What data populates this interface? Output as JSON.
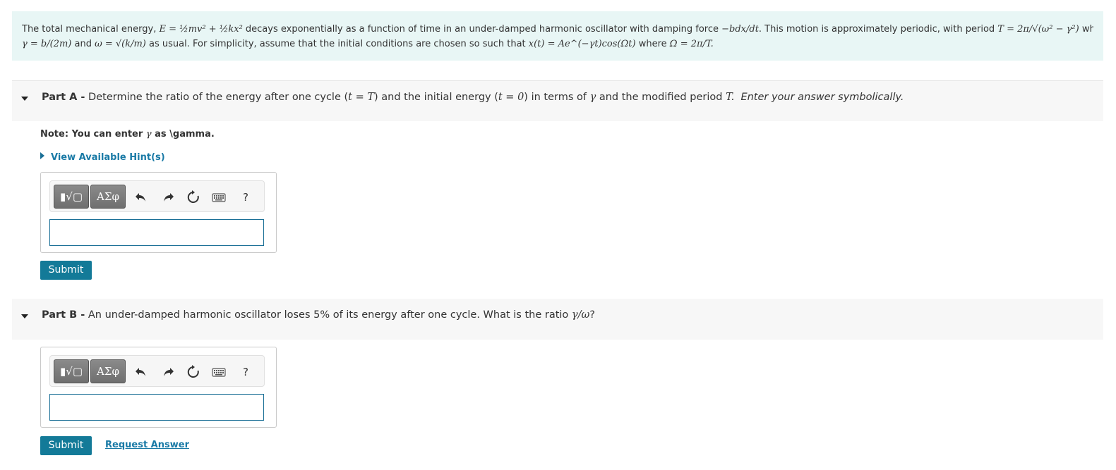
{
  "intro": {
    "line1_prefix": "The total mechanical energy, ",
    "line1_eq_energy": "E = ½mv² + ½kx²",
    "line1_mid": " decays exponentially as a function of time in an under-damped harmonic oscillator with damping force ",
    "line1_eq_force": "−bdx/dt",
    "line1_mid2": ". This motion is approximately periodic, with period ",
    "line1_eq_period": "T = 2π/√(ω² − γ²)",
    "line1_suffix": " where",
    "line2_eq_gamma": "γ = b/(2m)",
    "line2_and": " and ",
    "line2_eq_omega": "ω = √(k/m)",
    "line2_mid": " as usual. For simplicity, assume that the initial conditions are chosen so such that ",
    "line2_eq_x": "x(t) = Ae^(−γt)cos(Ωt)",
    "line2_where": " where ",
    "line2_eq_Omega": "Ω = 2π/T."
  },
  "part_a": {
    "name": "Part A -",
    "text1": " Determine the ratio of the energy after one cycle (",
    "eq1": "t = T",
    "text2": ") and the initial energy (",
    "eq2": "t = 0",
    "text3": ") in terms of ",
    "eq3": "γ",
    "text4": " and the modified period ",
    "eq4": "T.",
    "instruction": "Enter your answer symbolically.",
    "note_prefix": "Note: You can enter ",
    "note_symbol": "γ",
    "note_suffix": " as \\gamma.",
    "hint_label": "View Available Hint(s)",
    "submit_label": "Submit"
  },
  "part_b": {
    "name": "Part B -",
    "text": " An under-damped harmonic oscillator loses 5% of its energy after one cycle. What is the ratio ",
    "eq": "γ/ω",
    "text_end": "?",
    "submit_label": "Submit",
    "request_label": "Request Answer"
  },
  "toolbar": {
    "templates_label": "▮√▢",
    "symbols_label": "ΑΣφ",
    "help_label": "?"
  },
  "icons": [
    "templates-icon",
    "symbols-icon",
    "undo-icon",
    "redo-icon",
    "reset-icon",
    "keyboard-icon",
    "help-icon",
    "caret-down-icon",
    "caret-right-icon"
  ],
  "colors": {
    "intro_bg": "#e8f6f5",
    "link": "#1a7aa6",
    "submit_bg": "#137a98",
    "part_header_bg": "#f7f7f7"
  }
}
